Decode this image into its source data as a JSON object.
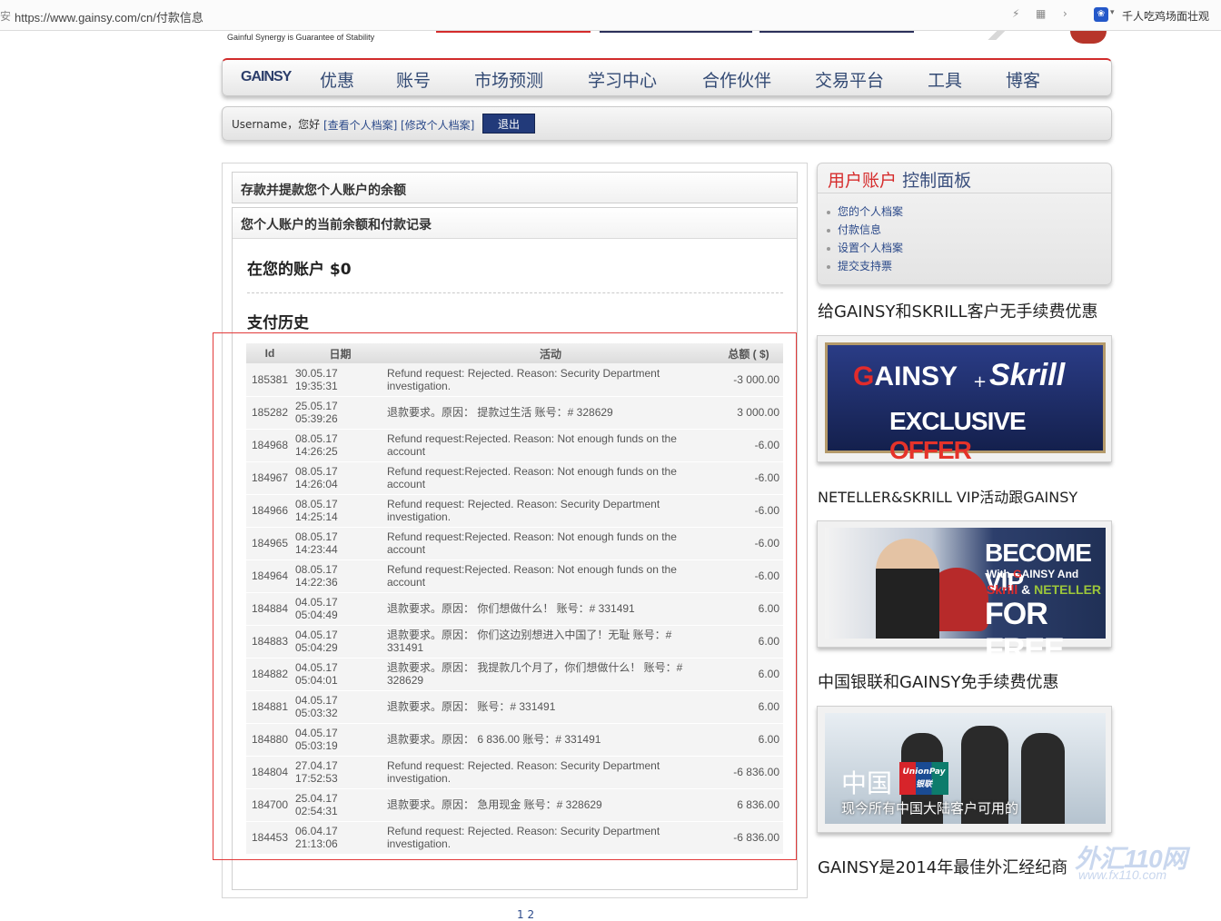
{
  "browser": {
    "security_glyph": "安",
    "url": "https://www.gainsy.com/cn/付款信息",
    "toolbar_icons": [
      "lightning-icon",
      "grid-icon",
      "chevron-right-icon"
    ],
    "news_text": "千人吃鸡场面壮观"
  },
  "site": {
    "tagline": "Gainful Synergy is Guarantee of Stability",
    "logo": "GAINSY",
    "nav": [
      "优惠",
      "账号",
      "市场预测",
      "学习中心",
      "合作伙伴",
      "交易平台",
      "工具",
      "博客"
    ]
  },
  "userbar": {
    "greeting": "Username，您好",
    "view_profile": "[查看个人档案]",
    "edit_profile": "[修改个人档案]",
    "logout": "退出"
  },
  "main": {
    "section_title": "存款并提款您个人账户的余额",
    "box_title": "您个人账户的当前余额和付款记录",
    "balance_label": "在您的账户 $0",
    "history_title": "支付历史",
    "columns": [
      "Id",
      "日期",
      "活动",
      "总额 ( $)"
    ],
    "rows": [
      {
        "id": "185381",
        "date": "30.05.17",
        "time": "19:35:31",
        "activity": "Refund request: Rejected. Reason: Security Department investigation.",
        "amount": "-3 000.00"
      },
      {
        "id": "185282",
        "date": "25.05.17",
        "time": "05:39:26",
        "activity": "退款要求。原因： 提款过生活 账号：# 328629",
        "amount": "3 000.00"
      },
      {
        "id": "184968",
        "date": "08.05.17",
        "time": "14:26:25",
        "activity": "Refund request:Rejected. Reason: Not enough funds on the account",
        "amount": "-6.00"
      },
      {
        "id": "184967",
        "date": "08.05.17",
        "time": "14:26:04",
        "activity": "Refund request:Rejected. Reason: Not enough funds on the account",
        "amount": "-6.00"
      },
      {
        "id": "184966",
        "date": "08.05.17",
        "time": "14:25:14",
        "activity": "Refund request: Rejected. Reason: Security Department investigation.",
        "amount": "-6.00"
      },
      {
        "id": "184965",
        "date": "08.05.17",
        "time": "14:23:44",
        "activity": "Refund request:Rejected. Reason: Not enough funds on the account",
        "amount": "-6.00"
      },
      {
        "id": "184964",
        "date": "08.05.17",
        "time": "14:22:36",
        "activity": "Refund request:Rejected. Reason: Not enough funds on the account",
        "amount": "-6.00"
      },
      {
        "id": "184884",
        "date": "04.05.17",
        "time": "05:04:49",
        "activity": "退款要求。原因： 你们想做什么！ 账号：# 331491",
        "amount": "6.00"
      },
      {
        "id": "184883",
        "date": "04.05.17",
        "time": "05:04:29",
        "activity": "退款要求。原因： 你们这边别想进入中国了！无耻 账号：# 331491",
        "amount": "6.00"
      },
      {
        "id": "184882",
        "date": "04.05.17",
        "time": "05:04:01",
        "activity": "退款要求。原因： 我提款几个月了，你们想做什么！ 账号：# 328629",
        "amount": "6.00"
      },
      {
        "id": "184881",
        "date": "04.05.17",
        "time": "05:03:32",
        "activity": "退款要求。原因： 账号：# 331491",
        "amount": "6.00"
      },
      {
        "id": "184880",
        "date": "04.05.17",
        "time": "05:03:19",
        "activity": "退款要求。原因： 6 836.00 账号：# 331491",
        "amount": "6.00"
      },
      {
        "id": "184804",
        "date": "27.04.17",
        "time": "17:52:53",
        "activity": "Refund request: Rejected. Reason: Security Department investigation.",
        "amount": "-6 836.00"
      },
      {
        "id": "184700",
        "date": "25.04.17",
        "time": "02:54:31",
        "activity": "退款要求。原因： 急用现金 账号：# 328629",
        "amount": "6 836.00"
      },
      {
        "id": "184453",
        "date": "06.04.17",
        "time": "21:13:06",
        "activity": "Refund request: Rejected. Reason: Security Department investigation.",
        "amount": "-6 836.00"
      }
    ],
    "pager": "1 2"
  },
  "sidebar": {
    "panel_title_red": "用户账户",
    "panel_title_blue": "控制面板",
    "links": [
      "您的个人档案",
      "付款信息",
      "设置个人档案",
      "提交支持票"
    ],
    "promo1_title": "给GAINSY和SKRILL客户无手续费优惠",
    "banner1": {
      "g": "G",
      "ainsy": "AINSY",
      "plus": "+",
      "skrill": "Skrill",
      "exclusive": "EXCLUSIVE",
      "offer": "OFFER"
    },
    "promo2_title": "NETELLER&SKRILL VIP活动跟GAINSY",
    "banner2": {
      "line1": "BECOME VIP",
      "with": "With ",
      "g": "G",
      "ainsy": "AINSY",
      "and": " And",
      "skrill": "Skrill",
      "amp": " & ",
      "neteller": "NETELLER",
      "line4": "FOR FREE"
    },
    "promo3_title": "中国银联和GAINSY免手续费优惠",
    "banner3": {
      "zh": "中国",
      "unionpay": "UnionPay 银联",
      "caption": "现今所有中国大陆客户可用的"
    },
    "promo4_title": "GAINSY是2014年最佳外汇经纪商"
  },
  "watermark": {
    "main": "外汇110网",
    "url": "www.fx110.com"
  },
  "colors": {
    "brand_red": "#d12b2b",
    "brand_navy": "#223a7a",
    "link_blue": "#2c4a8a",
    "highlight_box": "#e23a3a"
  }
}
